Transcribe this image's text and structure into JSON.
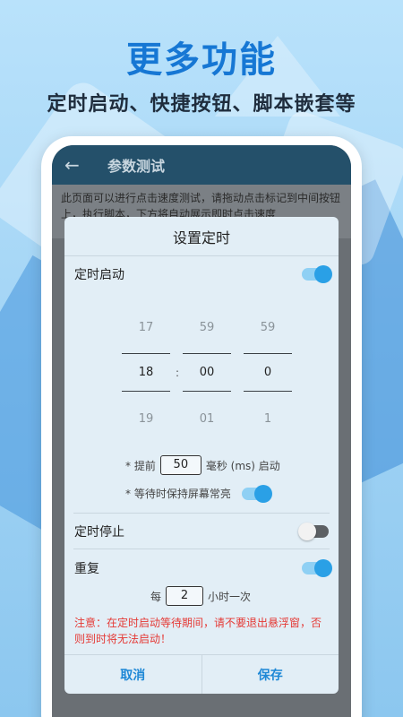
{
  "promo": {
    "headline": "更多功能",
    "subline": "定时启动、快捷按钮、脚本嵌套等"
  },
  "appbar": {
    "back_icon": "arrow-left-icon",
    "title": "参数测试"
  },
  "page": {
    "description": "此页面可以进行点击速度测试，请拖动点击标记到中间按钮上，执行脚本，下方将自动展示即时点击速度"
  },
  "dialog": {
    "title": "设置定时",
    "start": {
      "label": "定时启动",
      "enabled": true
    },
    "picker": {
      "hours": {
        "prev": "17",
        "current": "18",
        "next": "19"
      },
      "minutes": {
        "prev": "59",
        "current": "00",
        "next": "01"
      },
      "seconds": {
        "prev": "59",
        "current": "0",
        "next": "1"
      },
      "separator": ":"
    },
    "advance": {
      "prefix": "* 提前",
      "value": "50",
      "suffix": "毫秒 (ms) 启动"
    },
    "keep_screen": {
      "label": "* 等待时保持屏幕常亮",
      "enabled": true
    },
    "stop": {
      "label": "定时停止",
      "enabled": false
    },
    "repeat": {
      "label": "重复",
      "enabled": true,
      "prefix": "每",
      "value": "2",
      "suffix": "小时一次"
    },
    "warning": "注意：在定时启动等待期间，请不要退出悬浮窗，否则到时将无法启动！",
    "cancel_label": "取消",
    "save_label": "保存"
  },
  "colors": {
    "accent": "#2aa0e6",
    "headline": "#1677d4",
    "appbar": "#24506a",
    "warning": "#e53935"
  }
}
